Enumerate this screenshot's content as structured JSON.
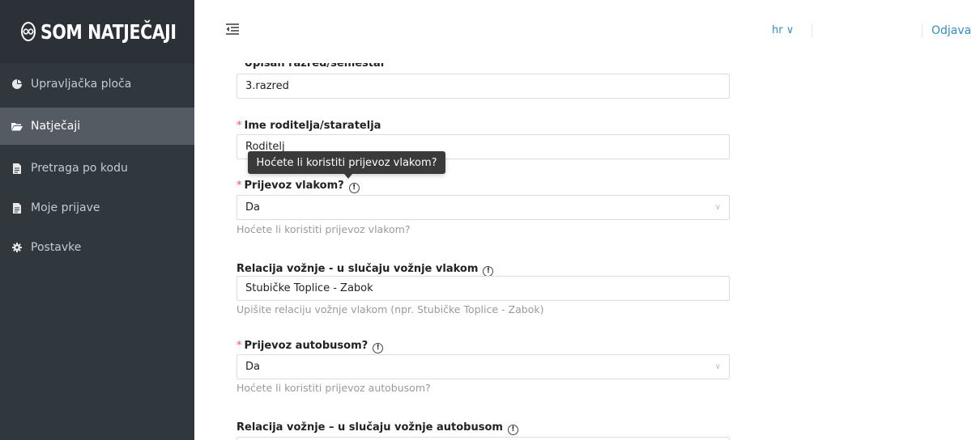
{
  "brand": {
    "logo_icon": "SOM",
    "name": "SOM NATJEČAJI"
  },
  "sidebar": {
    "items": [
      {
        "label": "Upravljačka ploča",
        "icon": "dashboard-pie-icon"
      },
      {
        "label": "Natječaji",
        "icon": "folder-open-icon",
        "active": true
      },
      {
        "label": "Pretraga po kodu",
        "icon": "document-icon"
      },
      {
        "label": "Moje prijave",
        "icon": "document-icon"
      },
      {
        "label": "Postavke",
        "icon": "gear-icon"
      }
    ]
  },
  "header": {
    "collapse_icon": "menu-fold-icon",
    "language": "hr ∨",
    "logout": "Odjava"
  },
  "form": {
    "grade": {
      "label": "Upisan razred/semestar",
      "value": "3.razred"
    },
    "parent": {
      "label": "Ime roditelja/staratelja",
      "value": "Roditelj"
    },
    "train": {
      "label": "Prijevoz vlakom?",
      "value": "Da",
      "help": "Hoćete li koristiti prijevoz vlakom?"
    },
    "train_route": {
      "label": "Relacija vožnje - u slučaju vožnje vlakom",
      "value": "Stubičke Toplice - Zabok",
      "help": "Upišite relaciju vožnje vlakom (npr. Stubičke Toplice - Zabok)"
    },
    "bus": {
      "label": "Prijevoz autobusom?",
      "value": "Da",
      "help": "Hoćete li koristiti prijevoz autobusom?"
    },
    "bus_route": {
      "label": "Relacija vožnje – u slučaju vožnje autobusom"
    }
  },
  "tooltip": {
    "text": "Hoćete li koristiti prijevoz vlakom?"
  },
  "colors": {
    "sidebar": "#30373d",
    "active": "#545b63",
    "link": "#2c8fd0",
    "required": "#ff4d4f"
  }
}
